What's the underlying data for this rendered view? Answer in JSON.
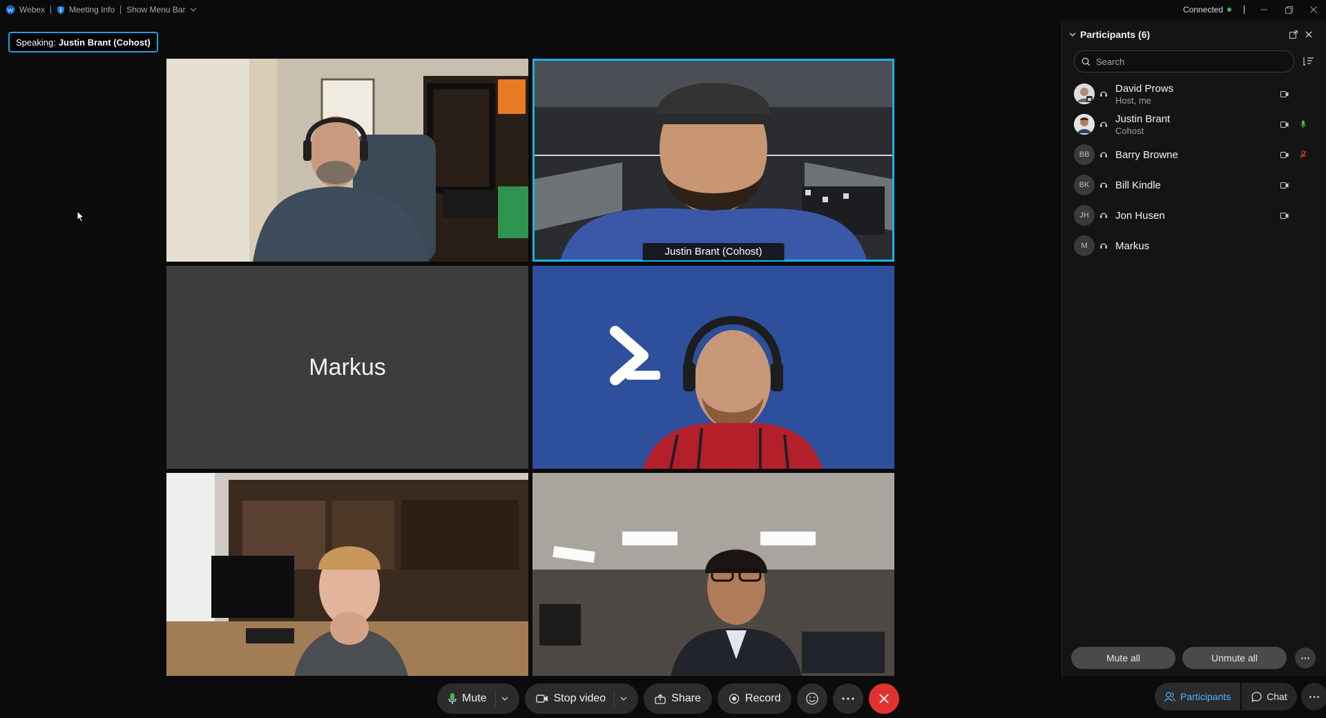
{
  "titlebar": {
    "app_name": "Webex",
    "meeting_info": "Meeting Info",
    "show_menu_bar": "Show Menu Bar",
    "connection_status": "Connected"
  },
  "speaking": {
    "prefix": "Speaking:",
    "name": "Justin Brant (Cohost)"
  },
  "tiles": [
    {
      "name": ""
    },
    {
      "label": "Justin Brant  (Cohost)"
    },
    {
      "name": "Markus"
    },
    {
      "name": ""
    },
    {
      "name": ""
    },
    {
      "name": ""
    }
  ],
  "controls": {
    "mute": "Mute",
    "stop_video": "Stop video",
    "share": "Share",
    "record": "Record"
  },
  "panel": {
    "title": "Participants (6)",
    "search_placeholder": "Search",
    "participants": [
      {
        "name": "David Prows",
        "role": "Host, me",
        "initials": "",
        "video": true,
        "mic": "none"
      },
      {
        "name": "Justin Brant",
        "role": "Cohost",
        "initials": "",
        "video": true,
        "mic": "active"
      },
      {
        "name": "Barry Browne",
        "role": "",
        "initials": "BB",
        "video": true,
        "mic": "muted"
      },
      {
        "name": "Bill Kindle",
        "role": "",
        "initials": "BK",
        "video": true,
        "mic": "none"
      },
      {
        "name": "Jon Husen",
        "role": "",
        "initials": "JH",
        "video": true,
        "mic": "none"
      },
      {
        "name": "Markus",
        "role": "",
        "initials": "M",
        "video": false,
        "mic": "none"
      }
    ],
    "mute_all": "Mute all",
    "unmute_all": "Unmute all"
  },
  "panel_tabs": {
    "participants": "Participants",
    "chat": "Chat"
  },
  "colors": {
    "accent": "#18b3e6",
    "end_call": "#e0332f",
    "muted": "#e0332f",
    "mic_active": "#3fba50",
    "tab_active": "#4fb4ff"
  }
}
